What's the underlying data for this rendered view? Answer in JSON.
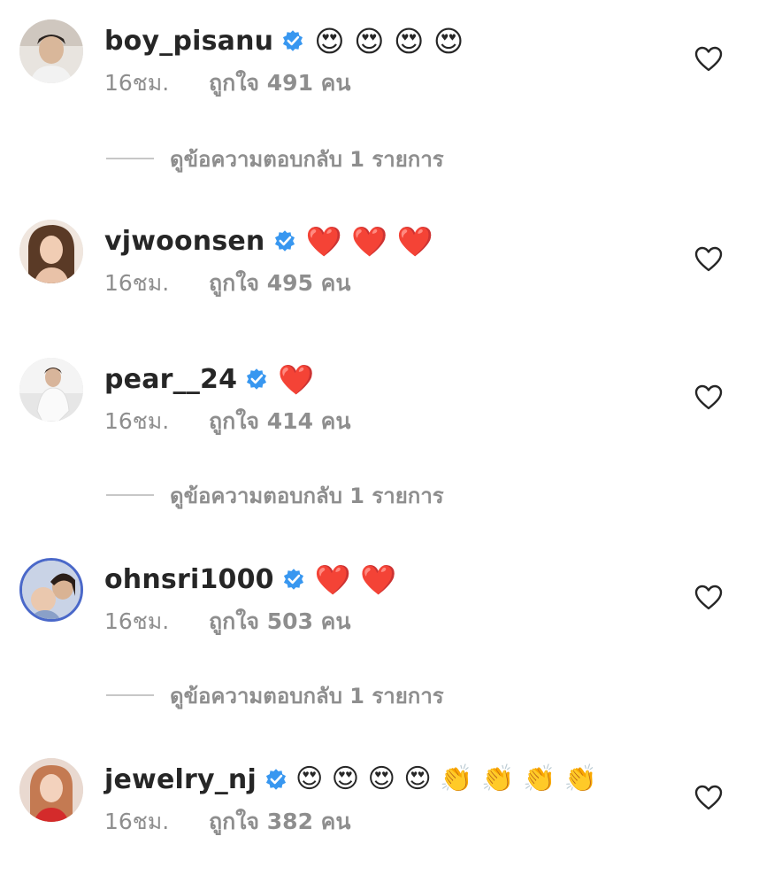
{
  "comments": [
    {
      "username": "boy_pisanu",
      "emoji": "😍 😍 😍 😍",
      "time": "16ชม.",
      "likes": "ถูกใจ 491 คน",
      "replies": "ดูข้อความตอบกลับ 1 รายการ"
    },
    {
      "username": "vjwoonsen",
      "emoji": "❤️ ❤️ ❤️",
      "time": "16ชม.",
      "likes": "ถูกใจ 495 คน"
    },
    {
      "username": "pear__24",
      "emoji": "❤️",
      "time": "16ชม.",
      "likes": "ถูกใจ 414 คน",
      "replies": "ดูข้อความตอบกลับ 1 รายการ"
    },
    {
      "username": "ohnsri1000",
      "emoji": "❤️ ❤️",
      "time": "16ชม.",
      "likes": "ถูกใจ 503 คน",
      "replies": "ดูข้อความตอบกลับ 1 รายการ"
    },
    {
      "username": "jewelry_nj",
      "emoji": "😍 😍 😍 😍 👏 👏 👏 👏",
      "time": "16ชม.",
      "likes": "ถูกใจ 382 คน"
    }
  ],
  "colors": {
    "verified": "#3897f0",
    "meta": "#8e8e8e",
    "text": "#262626"
  }
}
